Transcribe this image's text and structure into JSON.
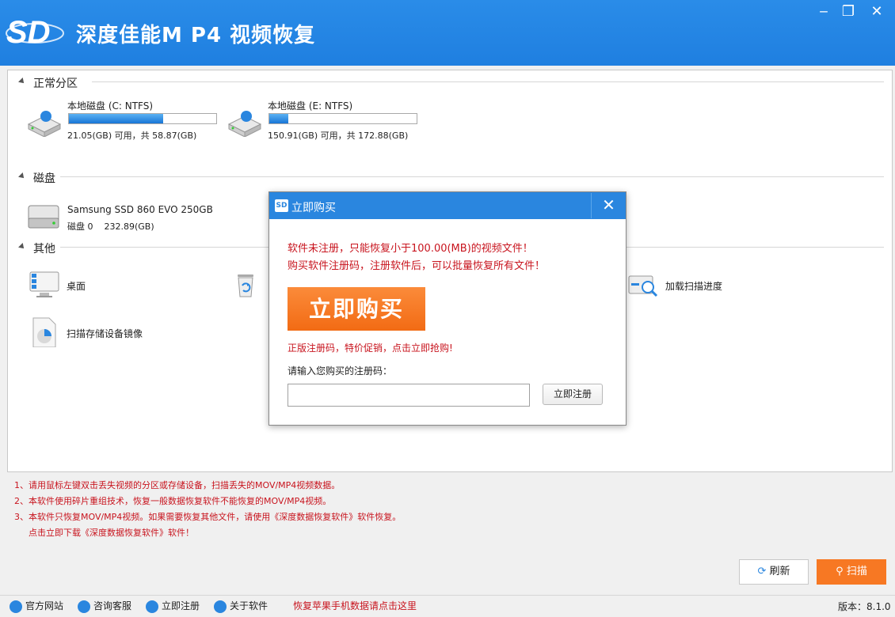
{
  "window": {
    "title": "深度佳能M P4 视频恢复",
    "logo_text": "SD",
    "minimize": "‒",
    "maximize": "❐",
    "close": "✕"
  },
  "sections": {
    "normal": "正常分区",
    "disk": "磁盘",
    "other": "其他"
  },
  "partitions": [
    {
      "name": "本地磁盘 (C: NTFS)",
      "info": "21.05(GB) 可用，共 58.87(GB)",
      "used_fraction": 0.64
    },
    {
      "name": "本地磁盘 (E: NTFS)",
      "info": "150.91(GB) 可用，共 172.88(GB)",
      "used_fraction": 0.13
    }
  ],
  "disk": {
    "name": "Samsung SSD 860 EVO 250GB",
    "info": "磁盘 0    232.89(GB)"
  },
  "others": [
    {
      "label": "桌面",
      "icon": "desktop-icon"
    },
    {
      "label": "",
      "icon": "recycle-bin-icon"
    },
    {
      "label": "加载扫描进度",
      "icon": "load-scan-progress-icon"
    },
    {
      "label": "扫描存储设备镜像",
      "icon": "disk-image-icon"
    }
  ],
  "notes": [
    "1、请用鼠标左键双击丢失视频的分区或存储设备，扫描丢失的MOV/MP4视频数据。",
    "2、本软件使用碎片重组技术，恢复一般数据恢复软件不能恢复的MOV/MP4视频。",
    "3、本软件只恢复MOV/MP4视频。如果需要恢复其他文件，请使用《深度数据恢复软件》软件恢复。",
    "点击立即下载《深度数据恢复软件》软件！"
  ],
  "buttons": {
    "refresh": "刷新",
    "scan": "扫描"
  },
  "statusbar": {
    "items": [
      "官方网站",
      "咨询客服",
      "立即注册",
      "关于软件"
    ],
    "promo": "恢复苹果手机数据请点击这里",
    "version": "版本：8.1.0"
  },
  "dialog": {
    "title": "立即购买",
    "close": "✕",
    "msg1": "软件未注册，只能恢复小于100.00(MB)的视频文件！",
    "msg2": "购买软件注册码，注册软件后，可以批量恢复所有文件！",
    "buy_button": "立即购买",
    "promo": "正版注册码，特价促销，点击立即抢购!",
    "input_label": "请输入您购买的注册码：",
    "input_value": "",
    "input_placeholder": "",
    "register_button": "立即注册"
  },
  "colors": {
    "titlebar": "#2a86df",
    "accent_orange": "#f77823",
    "warning_red": "#c8141e"
  }
}
